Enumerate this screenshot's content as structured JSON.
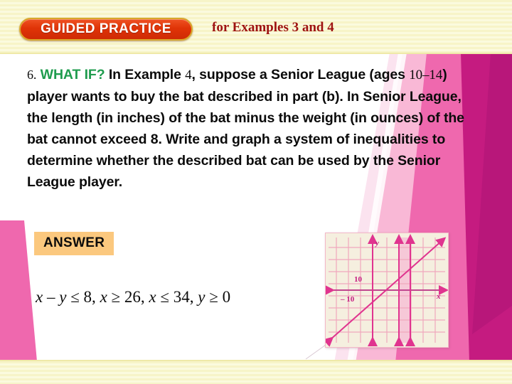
{
  "header": {
    "badge_label": "GUIDED PRACTICE",
    "subtitle": "for Examples 3 and 4"
  },
  "question": {
    "number": "6.",
    "highlight": "WHAT IF?",
    "segment_1": " In Example ",
    "example_number": "4",
    "segment_2": ", suppose a Senior League (ages ",
    "age_range": "10–14",
    "segment_3": ") player wants to buy the bat described in part (b). In Senior League, the length (in inches) of the bat minus the weight (in ounces) of the bat cannot exceed 8. Write and graph a system of inequalities to determine whether the described bat can be used by the Senior League player."
  },
  "answer": {
    "label": "ANSWER",
    "equation_parts": {
      "p1": "x",
      "p2": " – ",
      "p3": "y",
      "p4": " ≤ 8, ",
      "p5": "x",
      "p6": " ≥ 26, ",
      "p7": "x",
      "p8": " ≤ 34, ",
      "p9": "y",
      "p10": " ≥ 0"
    },
    "equation_plain": "x – y ≤ 8, x ≥ 26, x ≤ 34, y ≥ 0"
  },
  "graph": {
    "x_axis_label": "x",
    "y_axis_label": "y",
    "tick_label_positive": "10",
    "tick_label_negative": "– 10",
    "background_color": "#f5efdf",
    "grid_color": "#f0a8bd",
    "line_color": "#e0348f"
  },
  "chart_data": {
    "type": "line",
    "title": "",
    "xlabel": "x",
    "ylabel": "y",
    "xlim": [
      -20,
      60
    ],
    "ylim": [
      -40,
      40
    ],
    "grid": true,
    "legend": "none",
    "tick_labels": [
      "10",
      "– 10"
    ],
    "series": [
      {
        "name": "x – y = 8",
        "type": "line",
        "slope": 1,
        "intercept": -8
      },
      {
        "name": "x = 26",
        "type": "vertical-line",
        "value": 26
      },
      {
        "name": "x = 34",
        "type": "vertical-line",
        "value": 34
      }
    ],
    "shaded_region": {
      "x_from": 26,
      "x_to": 34
    }
  },
  "colors": {
    "badge_fill": "#e03407",
    "badge_border": "#d9a72a",
    "header_band": "#f7f4c8",
    "subtitle_text": "#9e1212",
    "highlight_green": "#1f9c4e",
    "answer_fill": "#fbc87e",
    "pink_light": "#f9b8d6",
    "pink_mid": "#ef68ae",
    "pink_dark": "#c51b80"
  }
}
